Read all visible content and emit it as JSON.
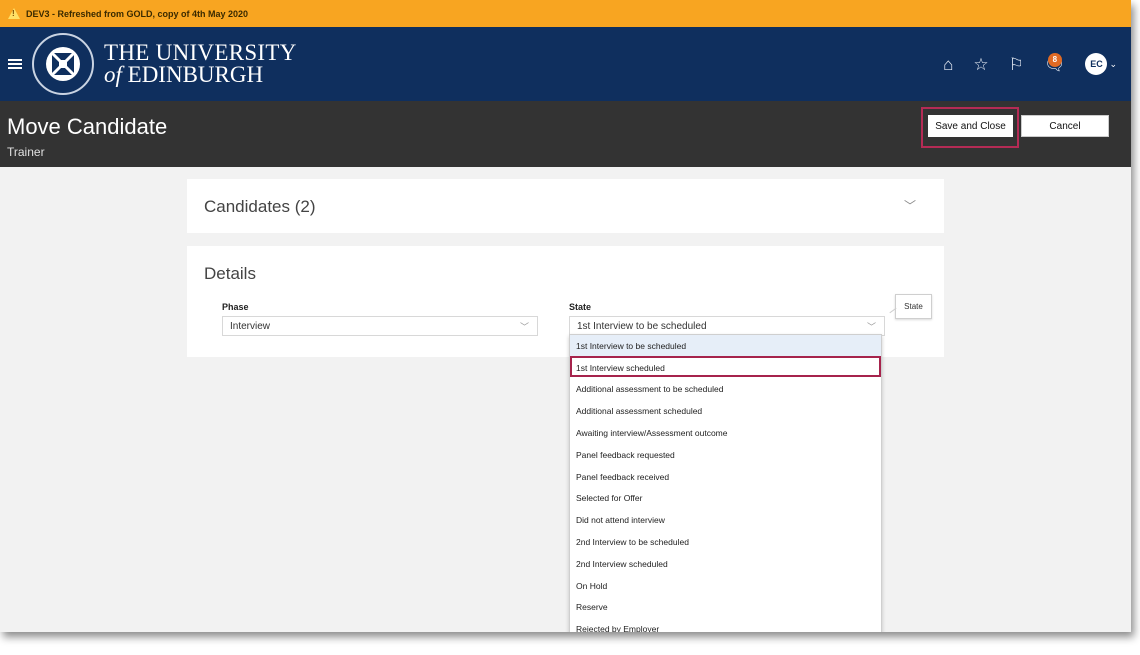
{
  "banner": {
    "text": "DEV3 - Refreshed from GOLD, copy of 4th May 2020"
  },
  "header": {
    "logo_line1": "THE UNIVERSITY",
    "logo_line2_prefix": "of",
    "logo_line2": "EDINBURGH",
    "notification_count": "8",
    "avatar_initials": "EC"
  },
  "page": {
    "title": "Move Candidate",
    "subtitle": "Trainer",
    "save_close_label": "Save and Close",
    "cancel_label": "Cancel"
  },
  "candidates": {
    "title": "Candidates (2)"
  },
  "details": {
    "title": "Details",
    "phase_label": "Phase",
    "phase_value": "Interview",
    "state_label": "State",
    "state_value": "1st Interview to be scheduled",
    "tooltip": "State"
  },
  "state_options": [
    "1st Interview to be scheduled",
    "1st Interview scheduled",
    "Additional assessment to be scheduled",
    "Additional assessment scheduled",
    "Awaiting interview/Assessment outcome",
    "Panel feedback requested",
    "Panel feedback received",
    "Selected for Offer",
    "Did not attend interview",
    "2nd Interview to be scheduled",
    "2nd Interview scheduled",
    "On Hold",
    "Reserve",
    "Rejected by Employer"
  ],
  "colors": {
    "banner": "#f8a521",
    "header": "#0f2f5e",
    "titlebar": "#333333",
    "highlight": "#a6234c",
    "badge": "#e06a24"
  }
}
